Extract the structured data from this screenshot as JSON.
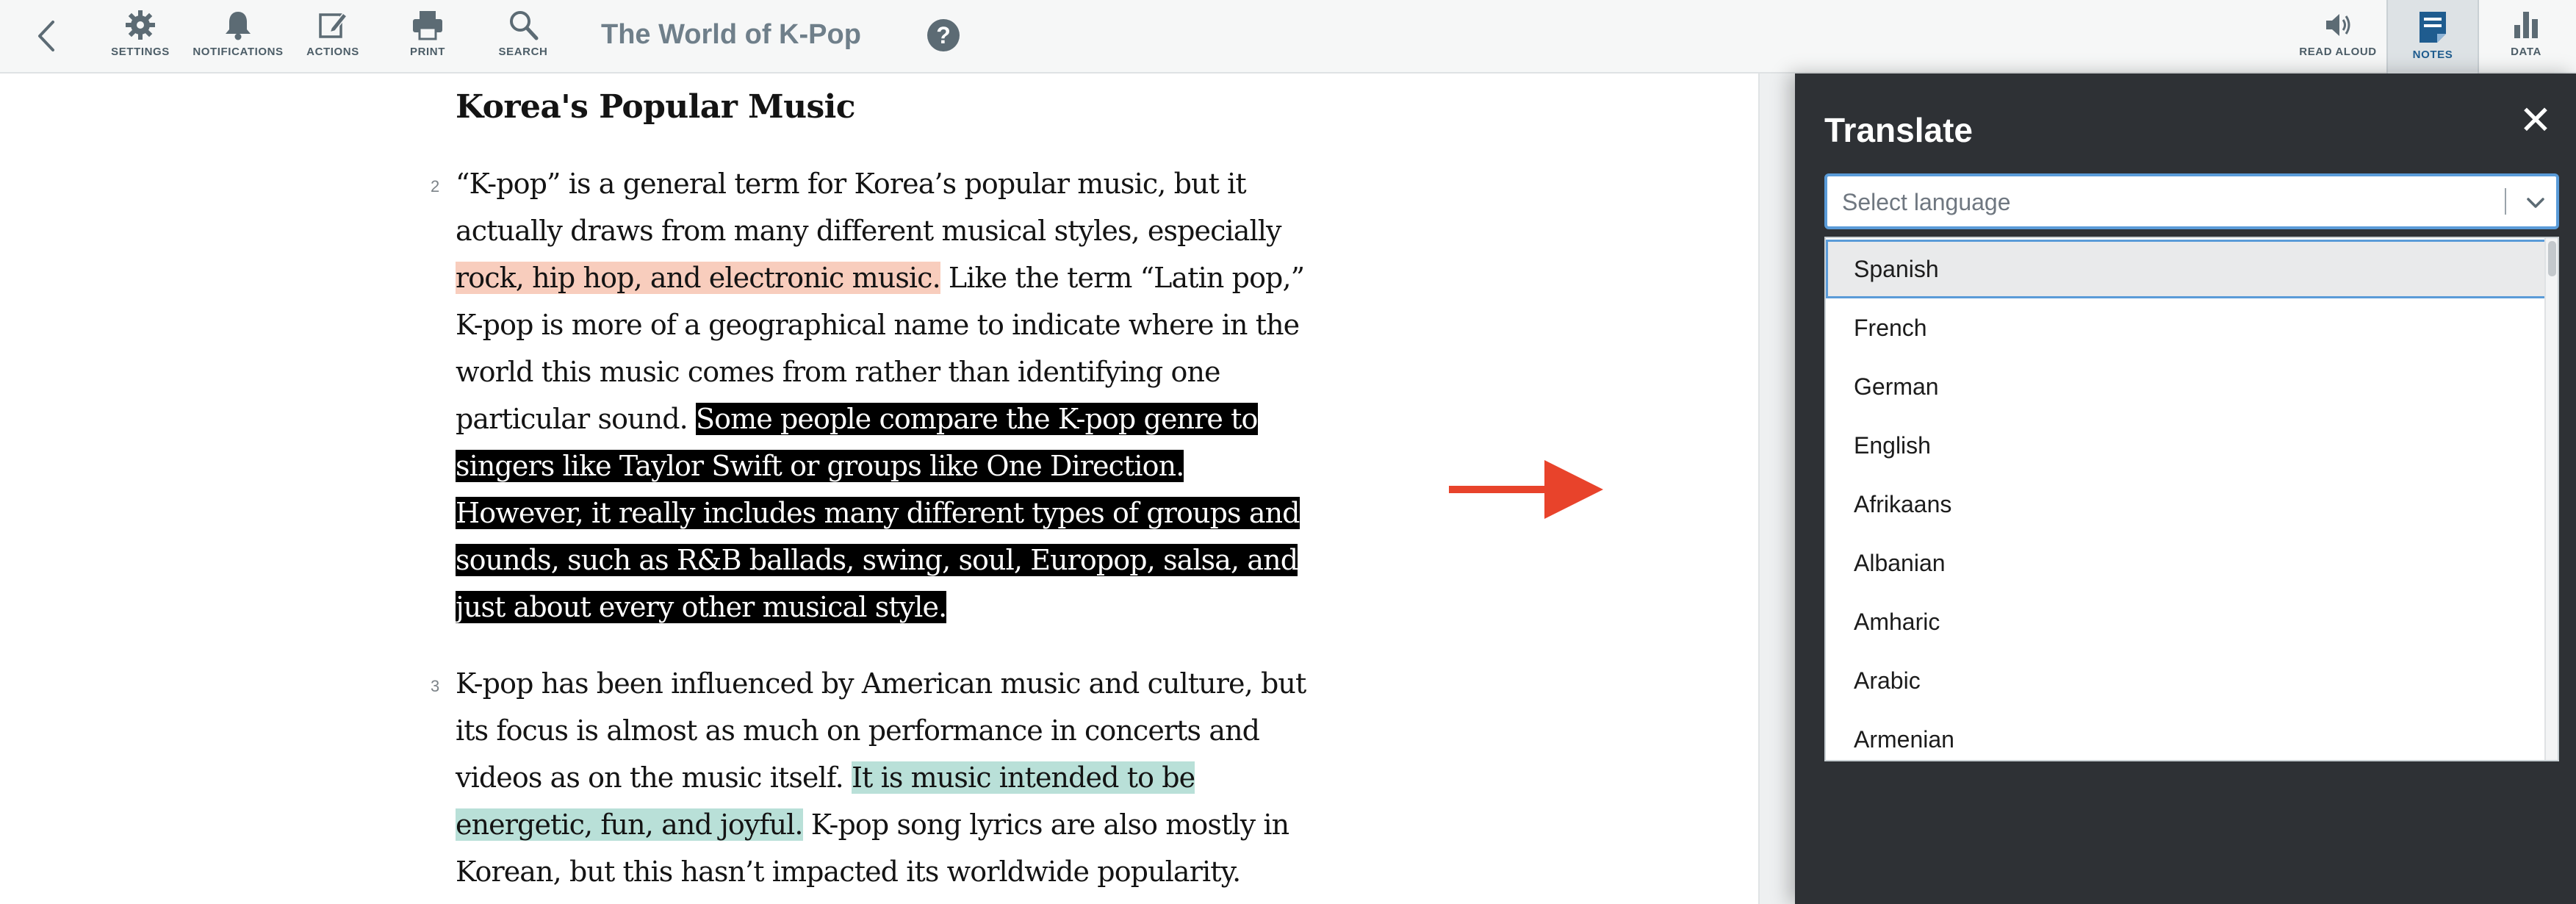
{
  "toolbar": {
    "title": "The World of K-Pop",
    "help_glyph": "?",
    "left_tools": [
      {
        "label": "SETTINGS",
        "icon": "gear-icon"
      },
      {
        "label": "NOTIFICATIONS",
        "icon": "bell-icon"
      },
      {
        "label": "ACTIONS",
        "icon": "edit-icon"
      },
      {
        "label": "PRINT",
        "icon": "printer-icon"
      },
      {
        "label": "SEARCH",
        "icon": "search-icon"
      }
    ],
    "right_tools": [
      {
        "label": "READ ALOUD",
        "icon": "speaker-icon"
      },
      {
        "label": "NOTES",
        "icon": "notes-icon",
        "active": true
      },
      {
        "label": "DATA",
        "icon": "bar-chart-icon"
      }
    ]
  },
  "article": {
    "heading": "Korea's Popular Music",
    "paragraphs": [
      {
        "number": "2",
        "segments": [
          {
            "text": "“K-pop” is a general term for Korea’s popular music, but it actually draws from many different musical styles, especially ",
            "highlight": "none"
          },
          {
            "text": "rock, hip hop, and electronic music.",
            "highlight": "salmon"
          },
          {
            "text": " Like the term “Latin pop,” K-pop is more of a geographical name to indicate where in the world this music comes from rather than identifying one particular sound. ",
            "highlight": "none"
          },
          {
            "text": "Some people compare the K-pop genre to singers like Taylor Swift or groups like One Direction. However, it really includes many different types of groups and sounds, such as R&B ballads, swing, soul, Europop, salsa, and just about every other musical style.",
            "highlight": "black"
          }
        ]
      },
      {
        "number": "3",
        "segments": [
          {
            "text": "K-pop has been influenced by American music and culture, but its focus is almost as much on performance in concerts and videos as on the music itself. ",
            "highlight": "none"
          },
          {
            "text": "It is music intended to be energetic, fun, and joyful.",
            "highlight": "teal"
          },
          {
            "text": " K-pop song lyrics are also mostly in Korean, but this hasn’t impacted its worldwide popularity.",
            "highlight": "none"
          }
        ]
      }
    ]
  },
  "translate_panel": {
    "title": "Translate",
    "close_glyph": "✕",
    "select_placeholder": "Select language",
    "options": [
      "Spanish",
      "French",
      "German",
      "English",
      "Afrikaans",
      "Albanian",
      "Amharic",
      "Arabic",
      "Armenian"
    ],
    "selected_option": "Spanish"
  },
  "colors": {
    "highlight_salmon": "#f8cdbd",
    "highlight_black": "#000000",
    "highlight_teal": "#b9e0d8",
    "arrow": "#e8432b",
    "panel_bg": "#2e3135",
    "focus_blue": "#5a9bd8"
  }
}
